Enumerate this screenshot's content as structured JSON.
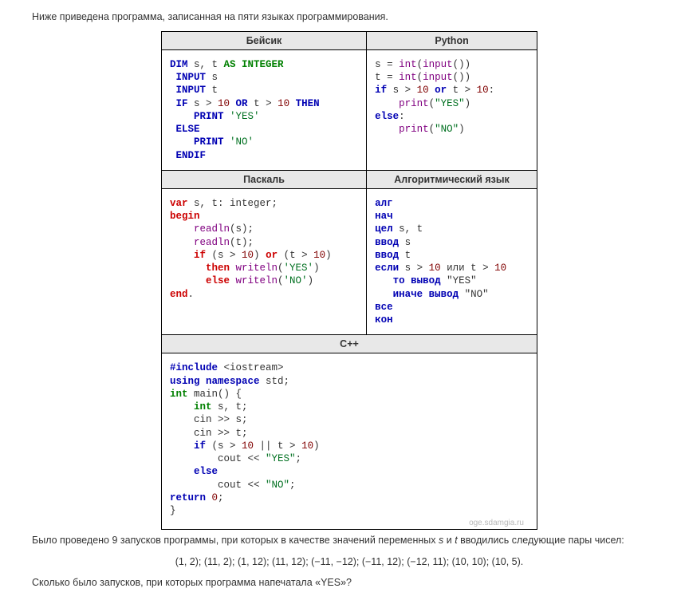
{
  "intro": "Ниже приведена программа, записанная на пяти языках программирования.",
  "headers": {
    "basic": "Бейсик",
    "python": "Python",
    "pascal": "Паскаль",
    "algo": "Алгоритмический язык",
    "cpp": "С++"
  },
  "watermark": "oge.sdamgia.ru",
  "para1_a": "Было проведено 9 запусков программы, при которых в качестве значений переменных ",
  "para1_v1": "s",
  "para1_mid": " и ",
  "para1_v2": "t",
  "para1_b": " вводились следующие пары чисел:",
  "pairs": "(1, 2); (11, 2); (1, 12); (11, 12); (−11, −12); (−11, 12); (−12, 11); (10, 10); (10, 5).",
  "question": "Сколько было запусков, при которых программа напечатала «YES»?",
  "code": {
    "basic": {
      "l1_a": "DIM",
      "l1_b": " s, t ",
      "l1_c": "AS INTEGER",
      "l2_a": " INPUT",
      "l2_b": " s",
      "l3_a": " INPUT",
      "l3_b": " t",
      "l4_a": " IF",
      "l4_b": " s > ",
      "l4_n1": "10",
      "l4_c": " OR",
      "l4_d": " t > ",
      "l4_n2": "10",
      "l4_e": " THEN",
      "l5_a": "    PRINT",
      "l5_b": " 'YES'",
      "l6": " ELSE",
      "l7_a": "    PRINT",
      "l7_b": " 'NO'",
      "l8": " ENDIF"
    },
    "python": {
      "l1_a": "s = ",
      "l1_b": "int",
      "l1_c": "(",
      "l1_d": "input",
      "l1_e": "())",
      "l2_a": "t = ",
      "l2_b": "int",
      "l2_c": "(",
      "l2_d": "input",
      "l2_e": "())",
      "l3_a": "if",
      "l3_b": " s > ",
      "l3_n1": "10",
      "l3_c": " or",
      "l3_d": " t > ",
      "l3_n2": "10",
      "l3_e": ":",
      "l4_a": "    print",
      "l4_b": "(",
      "l4_s": "\"YES\"",
      "l4_c": ")",
      "l5_a": "else",
      "l5_b": ":",
      "l6_a": "    print",
      "l6_b": "(",
      "l6_s": "\"NO\"",
      "l6_c": ")"
    },
    "pascal": {
      "l1_a": "var",
      "l1_b": " s, t: integer;",
      "l2": "begin",
      "l3_a": "    readln",
      "l3_b": "(s);",
      "l4_a": "    readln",
      "l4_b": "(t);",
      "l5_a": "    if",
      "l5_b": " (s > ",
      "l5_n1": "10",
      "l5_c": ") ",
      "l5_d": "or",
      "l5_e": " (t > ",
      "l5_n2": "10",
      "l5_f": ")",
      "l6_a": "      then",
      "l6_b": " writeln",
      "l6_c": "(",
      "l6_s": "'YES'",
      "l6_d": ")",
      "l7_a": "      else",
      "l7_b": " writeln",
      "l7_c": "(",
      "l7_s": "'NO'",
      "l7_d": ")",
      "l8_a": "end",
      "l8_b": "."
    },
    "algo": {
      "l1": "алг",
      "l2": "нач",
      "l3_a": "цел",
      "l3_b": " s, t",
      "l4_a": "ввод",
      "l4_b": " s",
      "l5_a": "ввод",
      "l5_b": " t",
      "l6_a": "если",
      "l6_b": " s > ",
      "l6_n1": "10",
      "l6_c": " или t > ",
      "l6_n2": "10",
      "l7_a": "   то вывод",
      "l7_b": " \"YES\"",
      "l8_a": "   иначе вывод",
      "l8_b": " \"NO\"",
      "l9": "все",
      "l10": "кон"
    },
    "cpp": {
      "l1_a": "#include",
      "l1_b": " <iostream>",
      "l2_a": "using namespace",
      "l2_b": " std;",
      "l3_a": "int",
      "l3_b": " main() {",
      "l4_a": "    int",
      "l4_b": " s, t;",
      "l5": "    cin >> s;",
      "l6": "    cin >> t;",
      "l7_a": "    if",
      "l7_b": " (s > ",
      "l7_n1": "10",
      "l7_c": " || t > ",
      "l7_n2": "10",
      "l7_d": ")",
      "l8_a": "        cout << ",
      "l8_s": "\"YES\"",
      "l8_b": ";",
      "l9": "    else",
      "l10_a": "        cout << ",
      "l10_s": "\"NO\"",
      "l10_b": ";",
      "l11_a": "return",
      "l11_b": " ",
      "l11_n": "0",
      "l11_c": ";",
      "l12": "}"
    }
  }
}
